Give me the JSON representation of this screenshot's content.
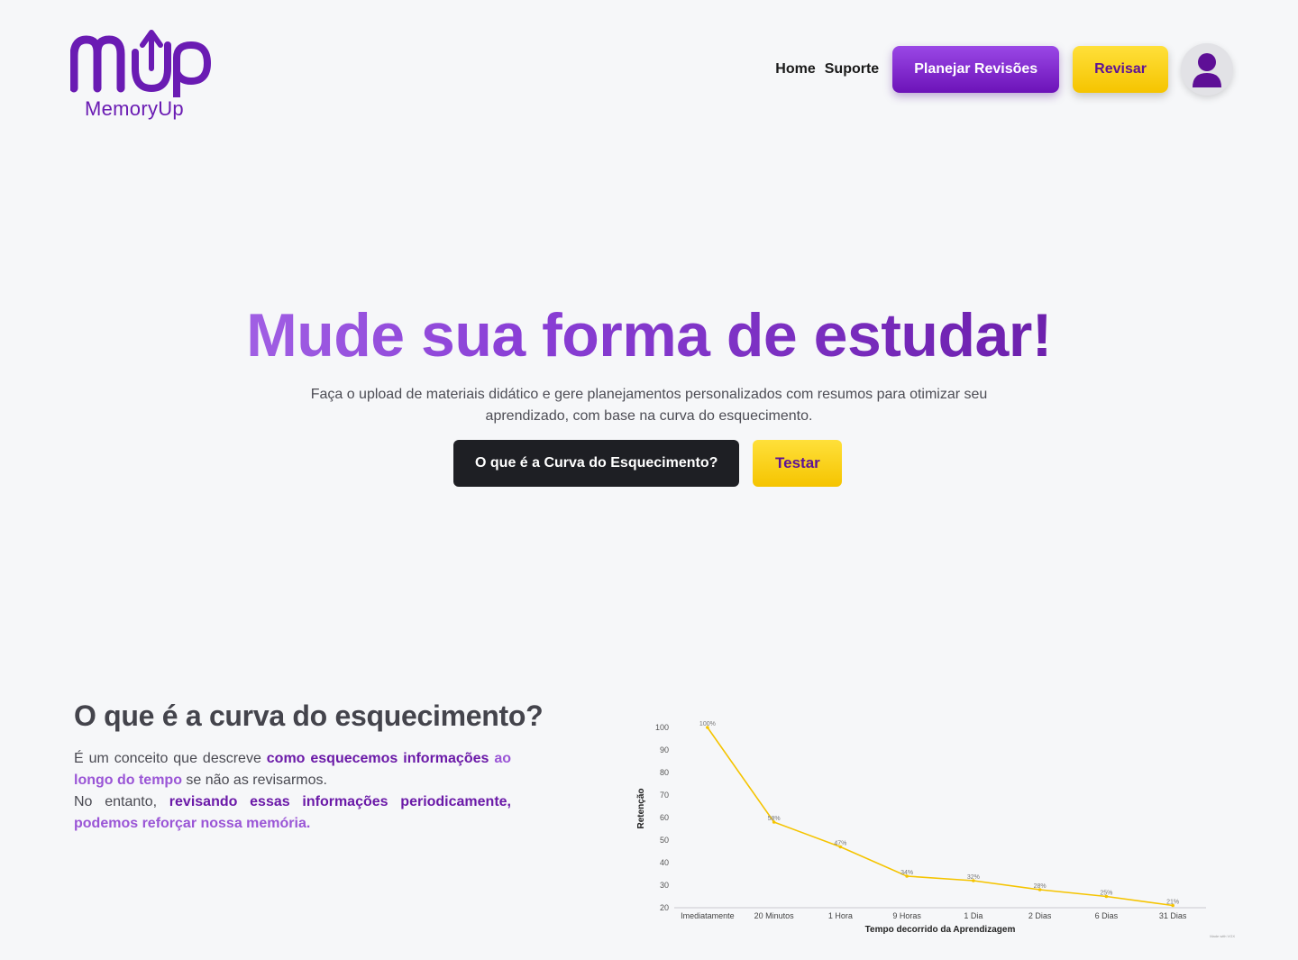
{
  "brand": {
    "mark": "mUp",
    "wordmark": "MemoryUp",
    "color": "#6a1bb3"
  },
  "nav": {
    "home": "Home",
    "suporte": "Suporte",
    "planejar": "Planejar Revisões",
    "revisar": "Revisar",
    "avatar_icon": "user-icon"
  },
  "hero": {
    "title": "Mude sua forma de estudar!",
    "subtitle": "Faça o upload de materiais didático e gere planejamentos personalizados com resumos para otimizar seu aprendizado, com base na curva do esquecimento.",
    "cta_primary": "O que é a Curva do Esquecimento?",
    "cta_secondary": "Testar"
  },
  "section": {
    "title": "O que é a curva do esquecimento?",
    "p1_a": "É um conceito que descreve ",
    "p1_hl1": "como esquecemos informações",
    "p1_hl2": "ao longo do tempo",
    "p1_b": " se não as revisarmos.",
    "p2_a": "No entanto, ",
    "p2_hl1": "revisando essas informações periodicamente,",
    "p2_hl2": "podemos reforçar nossa memória."
  },
  "colors": {
    "purple": "#6a1bb3",
    "yellow": "#f5c400",
    "dark": "#1e1f24"
  },
  "chart_data": {
    "type": "line",
    "categories": [
      "Imediatamente",
      "20 Minutos",
      "1 Hora",
      "9 Horas",
      "1 Dia",
      "2 Dias",
      "6 Dias",
      "31 Dias"
    ],
    "values": [
      100,
      58,
      47,
      34,
      32,
      28,
      25,
      21
    ],
    "data_labels": [
      "100%",
      "58%",
      "47%",
      "34%",
      "32%",
      "28%",
      "25%",
      "21%"
    ],
    "xlabel": "Tempo decorrido da Aprendizagem",
    "ylabel": "Retenção",
    "yticks": [
      20,
      30,
      40,
      50,
      60,
      70,
      80,
      90,
      100
    ],
    "ylim": [
      20,
      100
    ],
    "line_color": "#f5c400",
    "grid": false,
    "credit": "Made with VGX"
  }
}
